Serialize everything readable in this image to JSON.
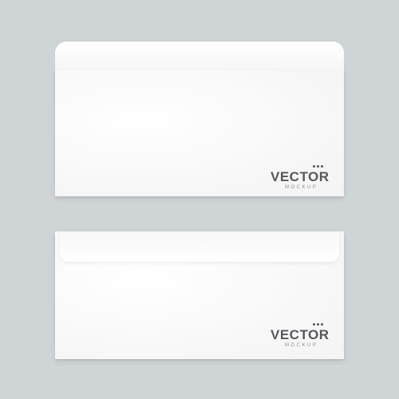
{
  "colors": {
    "background": "#cfd4d6",
    "envelope": "#fcfcfc",
    "logo_text": "#55595c"
  },
  "envelopes": [
    {
      "state": "open flap",
      "logo": {
        "word": "VECTOR",
        "sub": "MOCKUP"
      }
    },
    {
      "state": "closed flap",
      "logo": {
        "word": "VECTOR",
        "sub": "MOCKUP"
      }
    }
  ]
}
